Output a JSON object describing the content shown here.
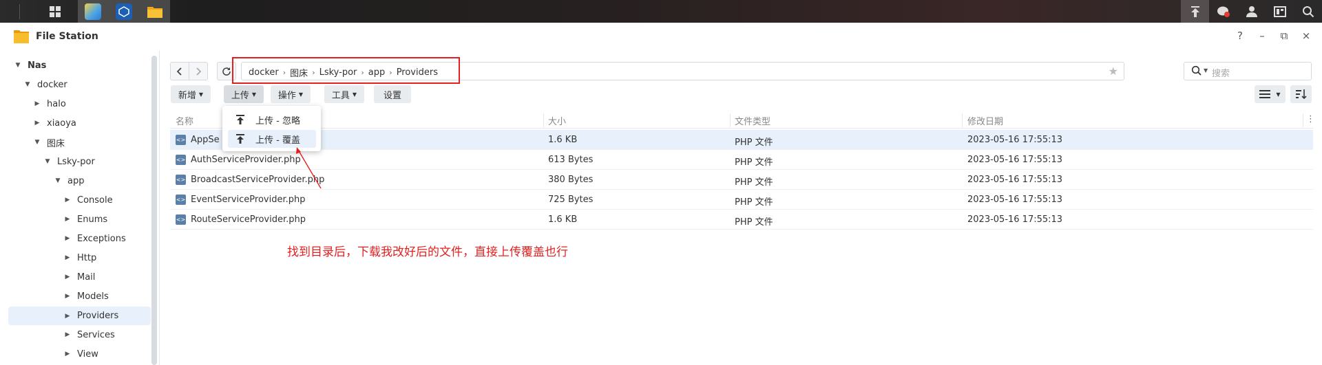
{
  "taskbar": {
    "left_icons": [
      "grid-icon"
    ],
    "apps": [
      "image-app-icon",
      "container-app-icon",
      "folder-app-icon"
    ],
    "right_icons": [
      "upload-icon",
      "chat-icon",
      "user-icon",
      "widget-icon",
      "search-icon"
    ]
  },
  "window": {
    "title": "File Station",
    "controls": {
      "help": "?",
      "minimize": "–",
      "restore": "⧉",
      "close": "×"
    }
  },
  "sidebar": {
    "items": [
      {
        "label": "Nas",
        "expanded": true
      },
      {
        "label": "docker",
        "expanded": true
      },
      {
        "label": "halo",
        "expanded": false
      },
      {
        "label": "xiaoya",
        "expanded": false
      },
      {
        "label": "图床",
        "expanded": true
      },
      {
        "label": "Lsky-por",
        "expanded": true
      },
      {
        "label": "app",
        "expanded": true
      },
      {
        "label": "Console",
        "expanded": false
      },
      {
        "label": "Enums",
        "expanded": false
      },
      {
        "label": "Exceptions",
        "expanded": false
      },
      {
        "label": "Http",
        "expanded": false
      },
      {
        "label": "Mail",
        "expanded": false
      },
      {
        "label": "Models",
        "expanded": false
      },
      {
        "label": "Providers",
        "expanded": false,
        "selected": true
      },
      {
        "label": "Services",
        "expanded": false
      },
      {
        "label": "View",
        "expanded": false
      }
    ]
  },
  "path": {
    "crumbs": [
      "docker",
      "图床",
      "Lsky-por",
      "app",
      "Providers"
    ]
  },
  "search": {
    "placeholder": "搜索"
  },
  "toolbar": {
    "new_label": "新增",
    "upload_label": "上传",
    "action_label": "操作",
    "tools_label": "工具",
    "settings_label": "设置"
  },
  "table": {
    "headers": [
      "名称",
      "大小",
      "文件类型",
      "修改日期"
    ],
    "rows": [
      {
        "name": "AppServiceProvider.php",
        "name_visible": "AppSe",
        "size": "1.6 KB",
        "type": "PHP 文件",
        "modified": "2023-05-16 17:55:13"
      },
      {
        "name": "AuthServiceProvider.php",
        "size": "613 Bytes",
        "type": "PHP 文件",
        "modified": "2023-05-16 17:55:13"
      },
      {
        "name": "BroadcastServiceProvider.php",
        "size": "380 Bytes",
        "type": "PHP 文件",
        "modified": "2023-05-16 17:55:13"
      },
      {
        "name": "EventServiceProvider.php",
        "size": "725 Bytes",
        "type": "PHP 文件",
        "modified": "2023-05-16 17:55:13"
      },
      {
        "name": "RouteServiceProvider.php",
        "size": "1.6 KB",
        "type": "PHP 文件",
        "modified": "2023-05-16 17:55:13"
      }
    ]
  },
  "upload_menu": {
    "items": [
      "上传 - 忽略",
      "上传 - 覆盖"
    ]
  },
  "annotation": {
    "text": "找到目录后，下载我改好后的文件，直接上传覆盖也行"
  },
  "colors": {
    "accent": "#e41f1f",
    "selection": "#e7f0fb",
    "file_icon": "#5a7fa8"
  }
}
